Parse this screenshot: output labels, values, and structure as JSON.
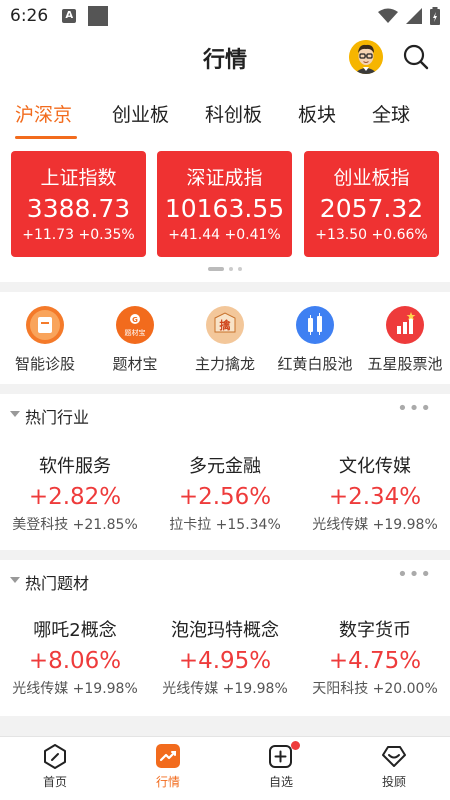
{
  "status_bar": {
    "time": "6:26",
    "notif_letter": "A"
  },
  "header": {
    "title": "行情"
  },
  "tabs": [
    {
      "label": "沪深京",
      "active": true
    },
    {
      "label": "创业板",
      "active": false
    },
    {
      "label": "科创板",
      "active": false
    },
    {
      "label": "板块",
      "active": false
    },
    {
      "label": "全球",
      "active": false
    }
  ],
  "index_cards": [
    {
      "name": "上证指数",
      "value": "3388.73",
      "change": "+11.73",
      "pct": "+0.35%"
    },
    {
      "name": "深证成指",
      "value": "10163.55",
      "change": "+41.44",
      "pct": "+0.41%"
    },
    {
      "name": "创业板指",
      "value": "2057.32",
      "change": "+13.50",
      "pct": "+0.66%"
    }
  ],
  "carousel": {
    "pages": 3,
    "active_page": 1
  },
  "tools": [
    {
      "label": "智能诊股",
      "icon": "diagnose-icon",
      "color": "#f47a2a"
    },
    {
      "label": "题材宝",
      "icon": "theme-treasure-icon",
      "color": "#f26b1d",
      "badge": "题材宝"
    },
    {
      "label": "主力擒龙",
      "icon": "dragon-icon",
      "color": "#f3c79a",
      "badge": "擒"
    },
    {
      "label": "红黄白股池",
      "icon": "stock-pool-icon",
      "color": "#3f80f2"
    },
    {
      "label": "五星股票池",
      "icon": "five-star-icon",
      "color": "#ee3b3b"
    }
  ],
  "hot_industries": {
    "title": "热门行业",
    "more": "•••",
    "items": [
      {
        "name": "软件服务",
        "pct": "+2.82%",
        "stock": "美登科技",
        "stock_pct": "+21.85%"
      },
      {
        "name": "多元金融",
        "pct": "+2.56%",
        "stock": "拉卡拉",
        "stock_pct": "+15.34%"
      },
      {
        "name": "文化传媒",
        "pct": "+2.34%",
        "stock": "光线传媒",
        "stock_pct": "+19.98%"
      }
    ]
  },
  "hot_themes": {
    "title": "热门题材",
    "more": "•••",
    "items": [
      {
        "name": "哪吒2概念",
        "pct": "+8.06%",
        "stock": "光线传媒",
        "stock_pct": "+19.98%"
      },
      {
        "name": "泡泡玛特概念",
        "pct": "+4.95%",
        "stock": "光线传媒",
        "stock_pct": "+19.98%"
      },
      {
        "name": "数字货币",
        "pct": "+4.75%",
        "stock": "天阳科技",
        "stock_pct": "+20.00%"
      }
    ]
  },
  "bottom_nav": [
    {
      "label": "首页",
      "icon": "home-icon",
      "active": false
    },
    {
      "label": "行情",
      "icon": "market-icon",
      "active": true
    },
    {
      "label": "自选",
      "icon": "watchlist-icon",
      "active": false,
      "has_dot": true
    },
    {
      "label": "投顾",
      "icon": "advisor-icon",
      "active": false
    }
  ],
  "colors": {
    "accent": "#f26b1d",
    "card_red": "#ef3232",
    "up_red": "#ee3b3b"
  }
}
